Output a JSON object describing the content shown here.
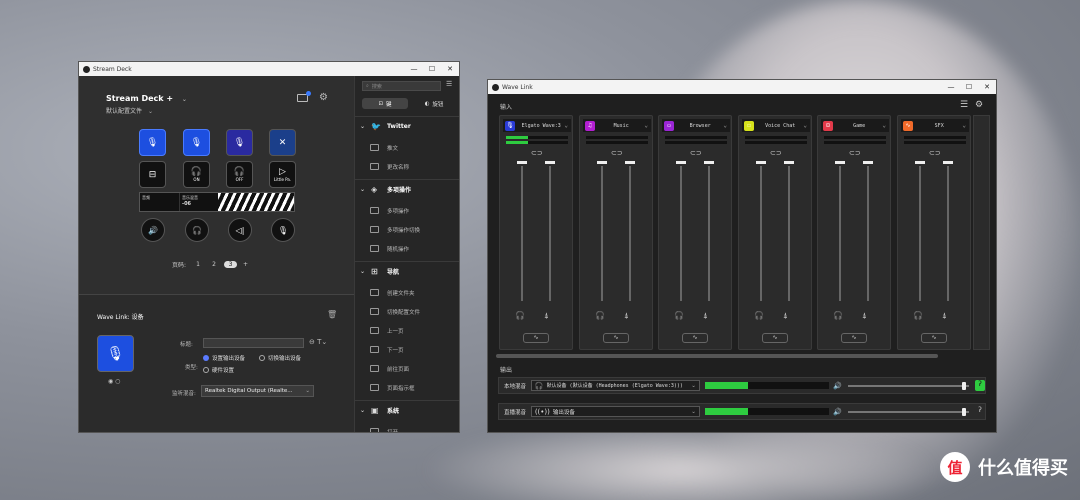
{
  "streamdeck": {
    "window_title": "Stream Deck",
    "device": "Stream Deck +",
    "profile": "默认配置文件",
    "page_label": "页码:",
    "pages": [
      "1",
      "2",
      "3"
    ],
    "active_page": "3",
    "add_page": "+",
    "key_row3_labels": [
      "ON",
      "OFF",
      "Little Pa."
    ],
    "touch_strip": [
      "音频",
      "音乐混音",
      "-06"
    ],
    "action_title": "Wave Link:  设备",
    "form": {
      "title_label": "标题:",
      "type_label": "类型:",
      "radio_options": [
        "设置输出设备",
        "切换输出设备",
        "硬件设置"
      ],
      "monitor_label": "监听混音:",
      "monitor_value": "Realtek Digital Output (Realte..."
    },
    "search_placeholder": "搜索",
    "tabs": [
      "键",
      "旋钮"
    ],
    "categories": [
      {
        "name": "Twitter",
        "icon": "twitter-icon",
        "items": [
          "推文",
          "更改名称"
        ]
      },
      {
        "name": "多项操作",
        "icon": "multi-action-icon",
        "items": [
          "多项操作",
          "多项操作切换",
          "随机操作"
        ]
      },
      {
        "name": "导航",
        "icon": "navigation-icon",
        "items": [
          "创建文件夹",
          "切换配置文件",
          "上一页",
          "下一页",
          "前往页面",
          "页面指示框"
        ]
      },
      {
        "name": "系统",
        "icon": "system-icon",
        "items": [
          "打开"
        ]
      }
    ]
  },
  "wavelink": {
    "window_title": "Wave Link",
    "input_label": "输入",
    "output_label": "输出",
    "channels": [
      {
        "name": "Elgato Wave:3",
        "color": "#2a3bd6",
        "icon": "microphone-icon",
        "glyph": "🎙",
        "level": 0.35
      },
      {
        "name": "Music",
        "color": "#b31fd1",
        "icon": "music-note-icon",
        "glyph": "♫",
        "level": 0
      },
      {
        "name": "Browser",
        "color": "#9b26d6",
        "icon": "browser-icon",
        "glyph": "▭",
        "level": 0
      },
      {
        "name": "Voice Chat",
        "color": "#d6e21b",
        "icon": "voice-chat-icon",
        "glyph": "☐",
        "level": 0
      },
      {
        "name": "Game",
        "color": "#e23a4a",
        "icon": "gamepad-icon",
        "glyph": "⊡",
        "level": 0
      },
      {
        "name": "SFX",
        "color": "#f06a2a",
        "icon": "sfx-icon",
        "glyph": "∿",
        "level": 0
      }
    ],
    "outputs": [
      {
        "label": "本地混音",
        "device": "默认设备 (默认设备 (Headphones (Elgato Wave:3)))",
        "level": 0.35,
        "volume": 0.97
      },
      {
        "label": "直播混音",
        "device": "输出设备",
        "level": 0.35,
        "volume": 0.97
      }
    ]
  },
  "watermark": {
    "logo": "值",
    "text": "什么值得买"
  }
}
